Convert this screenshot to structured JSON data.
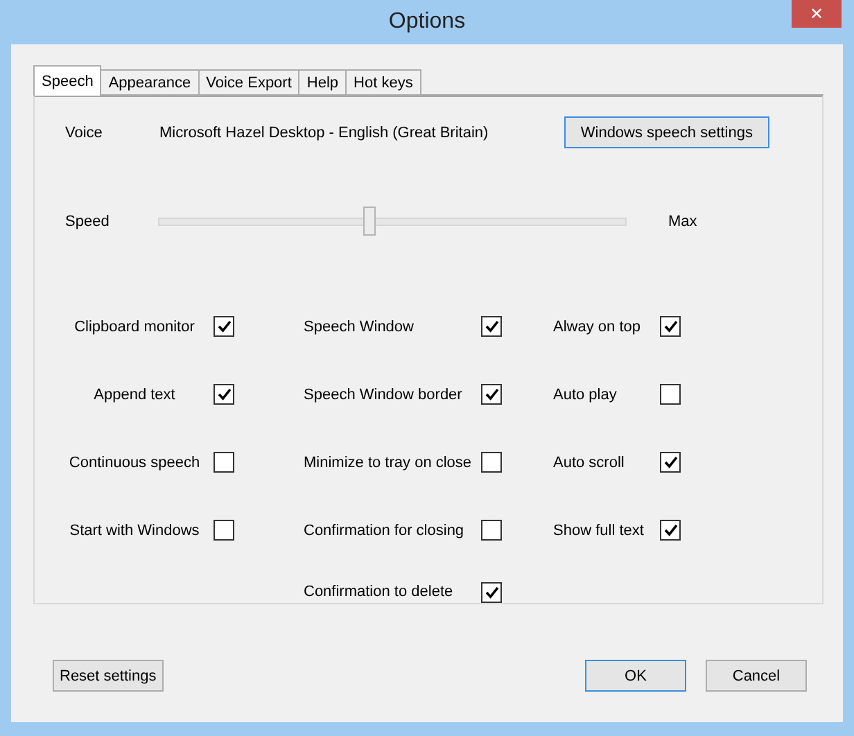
{
  "window": {
    "title": "Options",
    "close": "✕"
  },
  "tabs": [
    {
      "label": "Speech",
      "selected": true
    },
    {
      "label": "Appearance",
      "selected": false
    },
    {
      "label": "Voice Export",
      "selected": false
    },
    {
      "label": "Help",
      "selected": false
    },
    {
      "label": "Hot keys",
      "selected": false
    }
  ],
  "voice": {
    "label": "Voice",
    "value": "Microsoft Hazel Desktop - English (Great Britain)",
    "button": "Windows speech settings"
  },
  "speed": {
    "label": "Speed",
    "max_label": "Max",
    "level": 0.45
  },
  "columns": [
    [
      {
        "label": "Clipboard monitor",
        "checked": true
      },
      {
        "label": "Append text",
        "checked": true
      },
      {
        "label": "Continuous speech",
        "checked": false
      },
      {
        "label": "Start with Windows",
        "checked": false
      }
    ],
    [
      {
        "label": "Speech Window",
        "checked": true
      },
      {
        "label": "Speech Window border",
        "checked": true
      },
      {
        "label": "Minimize to tray on close",
        "checked": false
      },
      {
        "label": "Confirmation for closing",
        "checked": false
      },
      {
        "label": "Confirmation to delete",
        "checked": true
      }
    ],
    [
      {
        "label": "Alway on top",
        "checked": true
      },
      {
        "label": "Auto play",
        "checked": false
      },
      {
        "label": "Auto scroll",
        "checked": true
      },
      {
        "label": "Show full text",
        "checked": true
      }
    ]
  ],
  "buttons": {
    "reset": "Reset settings",
    "ok": "OK",
    "cancel": "Cancel"
  }
}
